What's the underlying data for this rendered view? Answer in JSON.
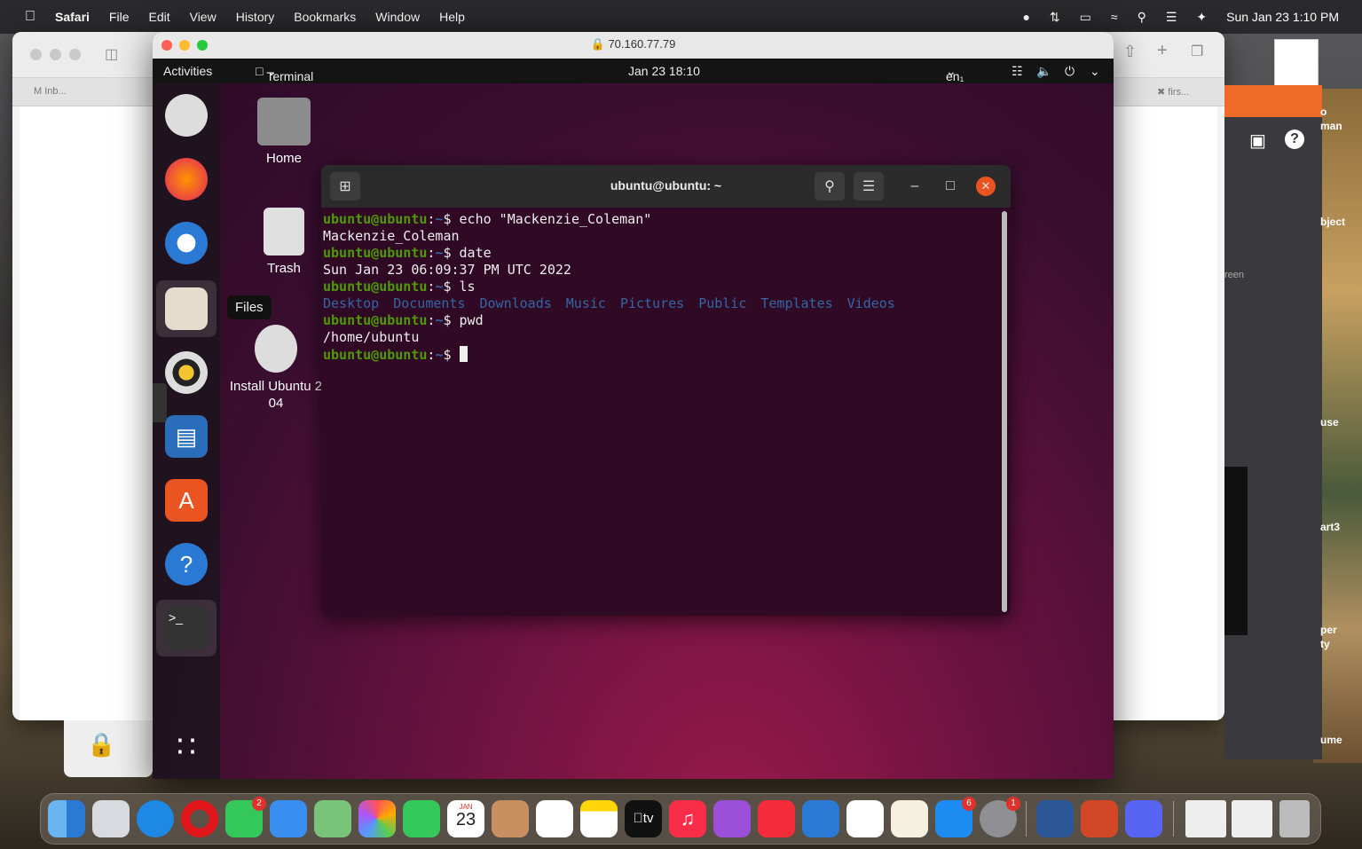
{
  "menubar": {
    "app_name": "Safari",
    "items": [
      "File",
      "Edit",
      "View",
      "History",
      "Bookmarks",
      "Window",
      "Help"
    ],
    "clock": "Sun Jan 23  1:10 PM"
  },
  "back_safari": {
    "tab1": "Inb...",
    "tab2": "firs..."
  },
  "side_panel": {
    "labels": [
      "o",
      "man",
      "bject",
      "reen",
      "use",
      "art3",
      "per",
      "ty",
      "ume"
    ]
  },
  "vm_window": {
    "url": "70.160.77.79"
  },
  "ubuntu_topbar": {
    "activities": "Activities",
    "app_menu": "Terminal",
    "clock": "Jan 23  18:10",
    "input_source": "en₁"
  },
  "desktop_icons": {
    "home": "Home",
    "trash": "Trash",
    "install": "Install Ubuntu 20.04",
    "install_line1": "Install Ubuntu 2",
    "install_line2": "04"
  },
  "tooltip": {
    "files": "Files"
  },
  "terminal": {
    "title": "ubuntu@ubuntu: ~",
    "prompt_user": "ubuntu@ubuntu",
    "prompt_path": "~",
    "lines": [
      {
        "type": "cmd",
        "text": "echo \"Mackenzie_Coleman\""
      },
      {
        "type": "out",
        "text": "Mackenzie_Coleman"
      },
      {
        "type": "cmd",
        "text": "date"
      },
      {
        "type": "out",
        "text": "Sun Jan 23 06:09:37 PM UTC 2022"
      },
      {
        "type": "cmd",
        "text": "ls"
      },
      {
        "type": "dirs",
        "items": [
          "Desktop",
          "Documents",
          "Downloads",
          "Music",
          "Pictures",
          "Public",
          "Templates",
          "Videos"
        ]
      },
      {
        "type": "cmd",
        "text": "pwd"
      },
      {
        "type": "out",
        "text": "/home/ubuntu"
      },
      {
        "type": "cmd",
        "text": ""
      }
    ]
  },
  "mac_dock": {
    "calendar_month": "JAN",
    "calendar_day": "23",
    "tv_label": "tv",
    "badges": {
      "messages": "2",
      "appstore": "6",
      "settings": "1"
    }
  }
}
